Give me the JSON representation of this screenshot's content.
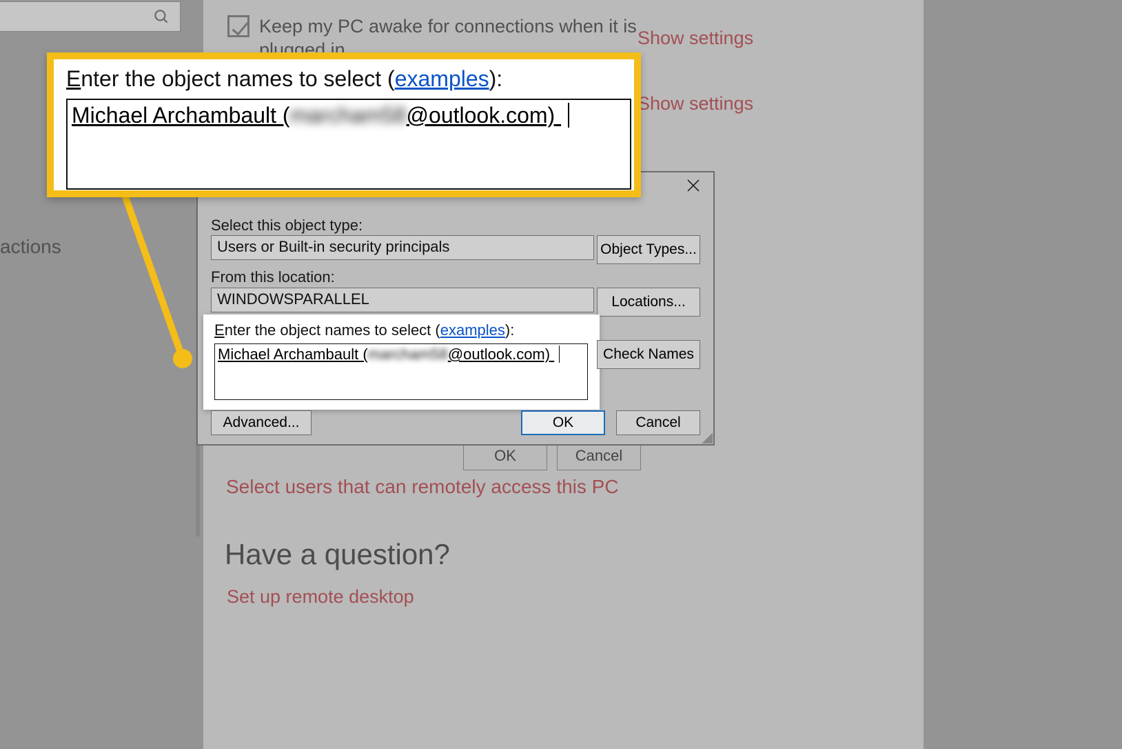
{
  "sidebar": {
    "actions_label": "actions"
  },
  "header": {
    "keep_awake_label": "Keep my PC awake for connections when it is plugged in",
    "show_settings_1": "Show settings",
    "show_settings_2": "Show settings"
  },
  "inner_dialog_buttons": {
    "ok": "OK",
    "cancel": "Cancel"
  },
  "links": {
    "select_users": "Select users that can remotely access this PC",
    "question_heading": "Have a question?",
    "setup_rd": "Set up remote desktop"
  },
  "dialog": {
    "close_icon": "close-icon",
    "object_type_label": "Select this object type:",
    "object_type_value": "Users or Built-in security principals",
    "object_types_btn": "Object Types...",
    "location_label": "From this location:",
    "location_value": "WINDOWSPARALLEL",
    "locations_btn": "Locations...",
    "names_label_pre": "Enter the object names to select (",
    "names_label_link": "examples",
    "names_label_post": "):",
    "names_value": "Michael Archambault (",
    "names_value_blur": "marcham58",
    "names_value_tail": "@outlook.com)",
    "check_names_btn": "Check Names",
    "advanced_btn": "Advanced...",
    "ok_btn": "OK",
    "cancel_btn": "Cancel"
  },
  "callout": {
    "label_pre": "Enter the object names to select (",
    "label_link": "examples",
    "label_post": "):",
    "value_head": "Michael Archambault (",
    "value_blur": "marcham58",
    "value_tail": "@outlook.com)"
  }
}
